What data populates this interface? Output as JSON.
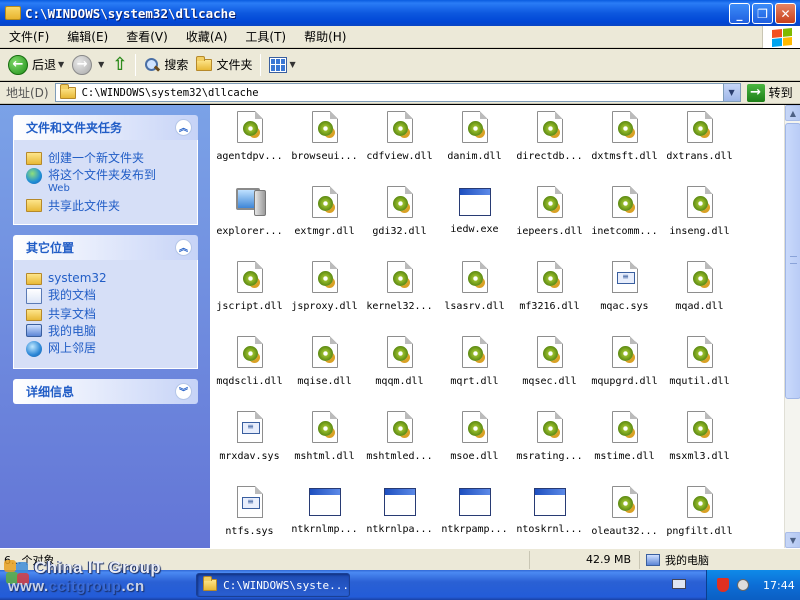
{
  "window": {
    "title": "C:\\WINDOWS\\system32\\dllcache",
    "buttons": {
      "minimize": "_",
      "maximize": "❐",
      "close": "✕"
    }
  },
  "menu": [
    "文件(F)",
    "编辑(E)",
    "查看(V)",
    "收藏(A)",
    "工具(T)",
    "帮助(H)"
  ],
  "toolbar": {
    "back_label": "后退",
    "search_label": "搜索",
    "folders_label": "文件夹"
  },
  "address": {
    "label": "地址(D)",
    "value": "C:\\WINDOWS\\system32\\dllcache",
    "go_label": "转到"
  },
  "taskpane": {
    "file_tasks": {
      "title": "文件和文件夹任务",
      "items": [
        {
          "label": "创建一个新文件夹",
          "icon": "new-folder-icon"
        },
        {
          "label": "将这个文件夹发布到",
          "sub": "Web",
          "icon": "web-publish-icon"
        },
        {
          "label": "共享此文件夹",
          "icon": "share-folder-icon"
        }
      ]
    },
    "other_places": {
      "title": "其它位置",
      "items": [
        {
          "label": "system32",
          "icon": "folder-icon"
        },
        {
          "label": "我的文档",
          "icon": "my-documents-icon"
        },
        {
          "label": "共享文档",
          "icon": "folder-icon"
        },
        {
          "label": "我的电脑",
          "icon": "my-computer-icon"
        },
        {
          "label": "网上邻居",
          "icon": "network-icon"
        }
      ]
    },
    "details": {
      "title": "详细信息"
    }
  },
  "files": [
    {
      "name": "agentdpv...",
      "type": "dll"
    },
    {
      "name": "browseui...",
      "type": "dll"
    },
    {
      "name": "cdfview.dll",
      "type": "dll"
    },
    {
      "name": "danim.dll",
      "type": "dll"
    },
    {
      "name": "directdb...",
      "type": "dll"
    },
    {
      "name": "dxtmsft.dll",
      "type": "dll"
    },
    {
      "name": "dxtrans.dll",
      "type": "dll"
    },
    {
      "name": "explorer...",
      "type": "explorer"
    },
    {
      "name": "extmgr.dll",
      "type": "dll"
    },
    {
      "name": "gdi32.dll",
      "type": "dll"
    },
    {
      "name": "iedw.exe",
      "type": "exe"
    },
    {
      "name": "iepeers.dll",
      "type": "dll"
    },
    {
      "name": "inetcomm...",
      "type": "dll"
    },
    {
      "name": "inseng.dll",
      "type": "dll"
    },
    {
      "name": "jscript.dll",
      "type": "dll"
    },
    {
      "name": "jsproxy.dll",
      "type": "dll"
    },
    {
      "name": "kernel32...",
      "type": "dll"
    },
    {
      "name": "lsasrv.dll",
      "type": "dll"
    },
    {
      "name": "mf3216.dll",
      "type": "dll"
    },
    {
      "name": "mqac.sys",
      "type": "sys"
    },
    {
      "name": "mqad.dll",
      "type": "dll"
    },
    {
      "name": "mqdscli.dll",
      "type": "dll"
    },
    {
      "name": "mqise.dll",
      "type": "dll"
    },
    {
      "name": "mqqm.dll",
      "type": "dll"
    },
    {
      "name": "mqrt.dll",
      "type": "dll"
    },
    {
      "name": "mqsec.dll",
      "type": "dll"
    },
    {
      "name": "mqupgrd.dll",
      "type": "dll"
    },
    {
      "name": "mqutil.dll",
      "type": "dll"
    },
    {
      "name": "mrxdav.sys",
      "type": "sys"
    },
    {
      "name": "mshtml.dll",
      "type": "dll"
    },
    {
      "name": "mshtmled...",
      "type": "dll"
    },
    {
      "name": "msoe.dll",
      "type": "dll"
    },
    {
      "name": "msrating...",
      "type": "dll"
    },
    {
      "name": "mstime.dll",
      "type": "dll"
    },
    {
      "name": "msxml3.dll",
      "type": "dll"
    },
    {
      "name": "ntfs.sys",
      "type": "sys"
    },
    {
      "name": "ntkrnlmp...",
      "type": "exe"
    },
    {
      "name": "ntkrnlpa...",
      "type": "exe"
    },
    {
      "name": "ntkrpamp...",
      "type": "exe"
    },
    {
      "name": "ntoskrnl...",
      "type": "exe"
    },
    {
      "name": "oleaut32...",
      "type": "dll"
    },
    {
      "name": "pngfilt.dll",
      "type": "dll"
    }
  ],
  "status": {
    "count": "6...个对象",
    "size": "42.9 MB",
    "location": "我的电脑"
  },
  "watermark": {
    "line1": "China IT Group",
    "line2_prefix": "www.",
    "line2_main": "ccitgroup",
    "line2_suffix": ".cn"
  },
  "taskbar": {
    "window_button": "C:\\WINDOWS\\syste...",
    "time": "17:44"
  }
}
